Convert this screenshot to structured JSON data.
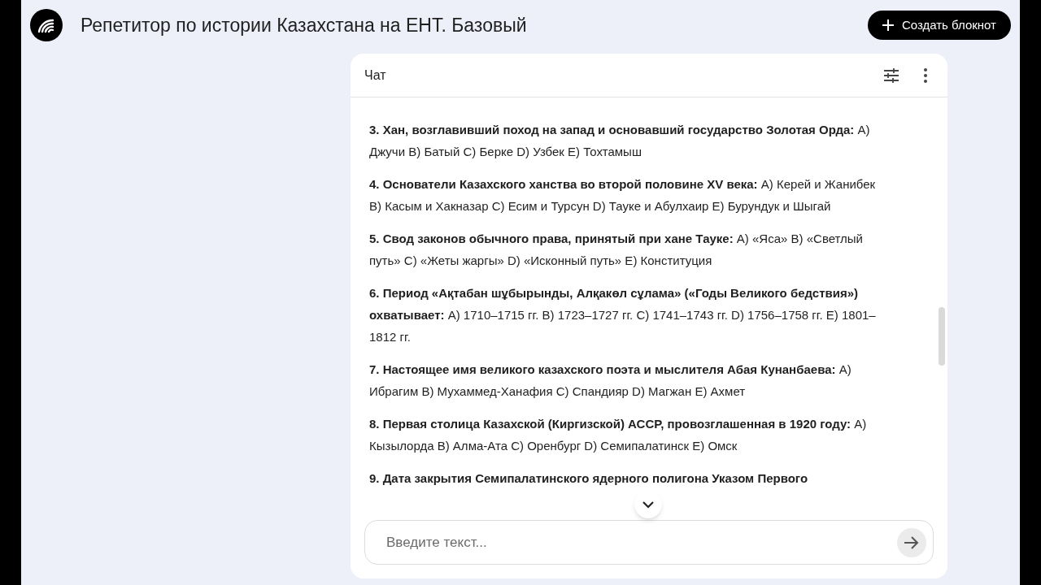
{
  "header": {
    "title": "Репетитор по истории Казахстана на ЕНТ. Базовый",
    "create_button": "Создать блокнот"
  },
  "chat": {
    "title": "Чат",
    "messages": [
      "**3. Хан, возглавивший поход на запад и основавший государство Золотая Орда:** A) Джучи B) Батый C) Берке D) Узбек E) Тохтамыш",
      "**4. Основатели Казахского ханства во второй половине XV века:** A) Керей и Жанибек B) Касым и Хакназар C) Есим и Турсун D) Тауке и Абулхаир E) Бурундук и Шыгай",
      "**5. Свод законов обычного права, принятый при хане Тауке:** A) «Яса» B) «Светлый путь» C) «Жеты жаргы» D) «Исконный путь» E) Конституция",
      "**6. Период «Ақтабан шұбырынды, Алқакөл сұлама» («Годы Великого бедствия») охватывает:** A) 1710–1715 гг. B) 1723–1727 гг. C) 1741–1743 гг. D) 1756–1758 гг. E) 1801–1812 гг.",
      "**7. Настоящее имя великого казахского поэта и мыслителя Абая Кунанбаева:** A) Ибрагим B) Мухаммед-Ханафия C) Спандияр D) Магжан E) Ахмет",
      "**8. Первая столица Казахской (Киргизской) АССР, провозглашенная в 1920 году:** A) Кызылорда B) Алма-Ата C) Оренбург D) Семипалатинск E) Омск",
      "**9. Дата закрытия Семипалатинского ядерного полигона Указом Первого**"
    ],
    "input": {
      "placeholder": "Введите текст..."
    }
  }
}
